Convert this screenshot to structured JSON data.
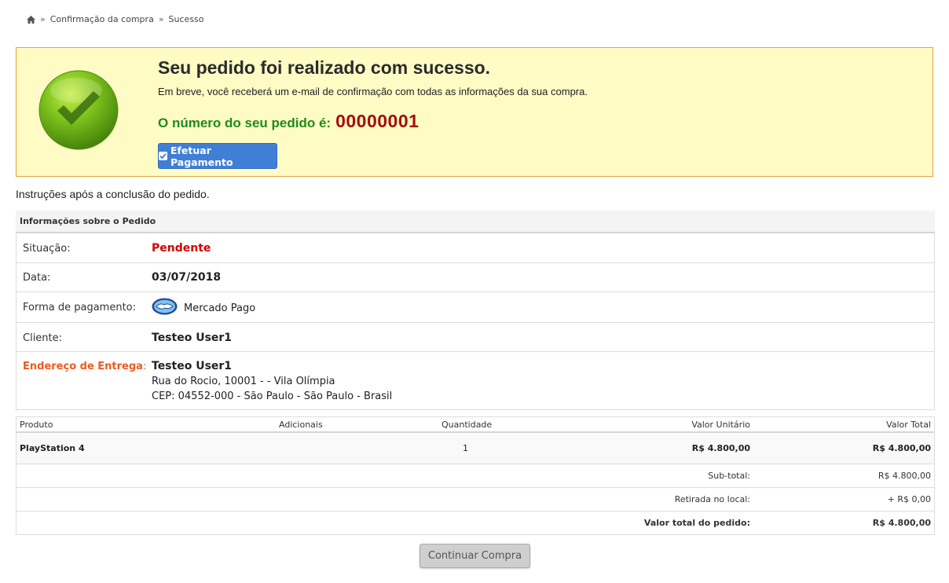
{
  "breadcrumb": {
    "home_icon": "home-icon",
    "separator": "»",
    "items": [
      "Confirmação da compra",
      "Sucesso"
    ]
  },
  "success": {
    "icon": "check-circle-icon",
    "title": "Seu pedido foi realizado com sucesso.",
    "subtitle": "Em breve, você receberá um e-mail de confirmação com todas as informações da sua compra.",
    "order_label": "O número do seu pedido é:",
    "order_number": "00000001",
    "pay_button": "Efetuar Pagamento",
    "colors": {
      "background": "#fffbc4",
      "border": "#e8a33a",
      "order_label": "#1f8a1f",
      "order_number": "#a50d0d",
      "button": "#3f7fd6"
    }
  },
  "instructions": "Instruções após a conclusão do pedido.",
  "order_info": {
    "header": "Informações sobre o Pedido",
    "status_label": "Situação:",
    "status_value": "Pendente",
    "date_label": "Data:",
    "date_value": "03/07/2018",
    "payment_label": "Forma de pagamento:",
    "payment_icon": "mercado-pago-icon",
    "payment_value": "Mercado Pago",
    "client_label": "Cliente:",
    "client_value": "Testeo User1",
    "address_label": "Endereço de Entrega",
    "address_colon": ":",
    "address_name": "Testeo User1",
    "address_line1": "Rua do Rocio, 10001 - - Vila Olímpia",
    "address_line2": "CEP: 04552-000 - São Paulo - São Paulo - Brasil"
  },
  "products": {
    "columns": {
      "product": "Produto",
      "extras": "Adicionais",
      "quantity": "Quantidade",
      "unit_price": "Valor Unitário",
      "total": "Valor Total"
    },
    "items": [
      {
        "name": "PlayStation 4",
        "extras": "",
        "quantity": "1",
        "unit_price": "R$ 4.800,00",
        "total": "R$ 4.800,00"
      }
    ],
    "subtotal_label": "Sub-total:",
    "subtotal_value": "R$ 4.800,00",
    "shipping_label": "Retirada no local:",
    "shipping_value": "+ R$ 0,00",
    "grand_total_label": "Valor total do pedido:",
    "grand_total_value": "R$ 4.800,00"
  },
  "continue_button": "Continuar Compra"
}
